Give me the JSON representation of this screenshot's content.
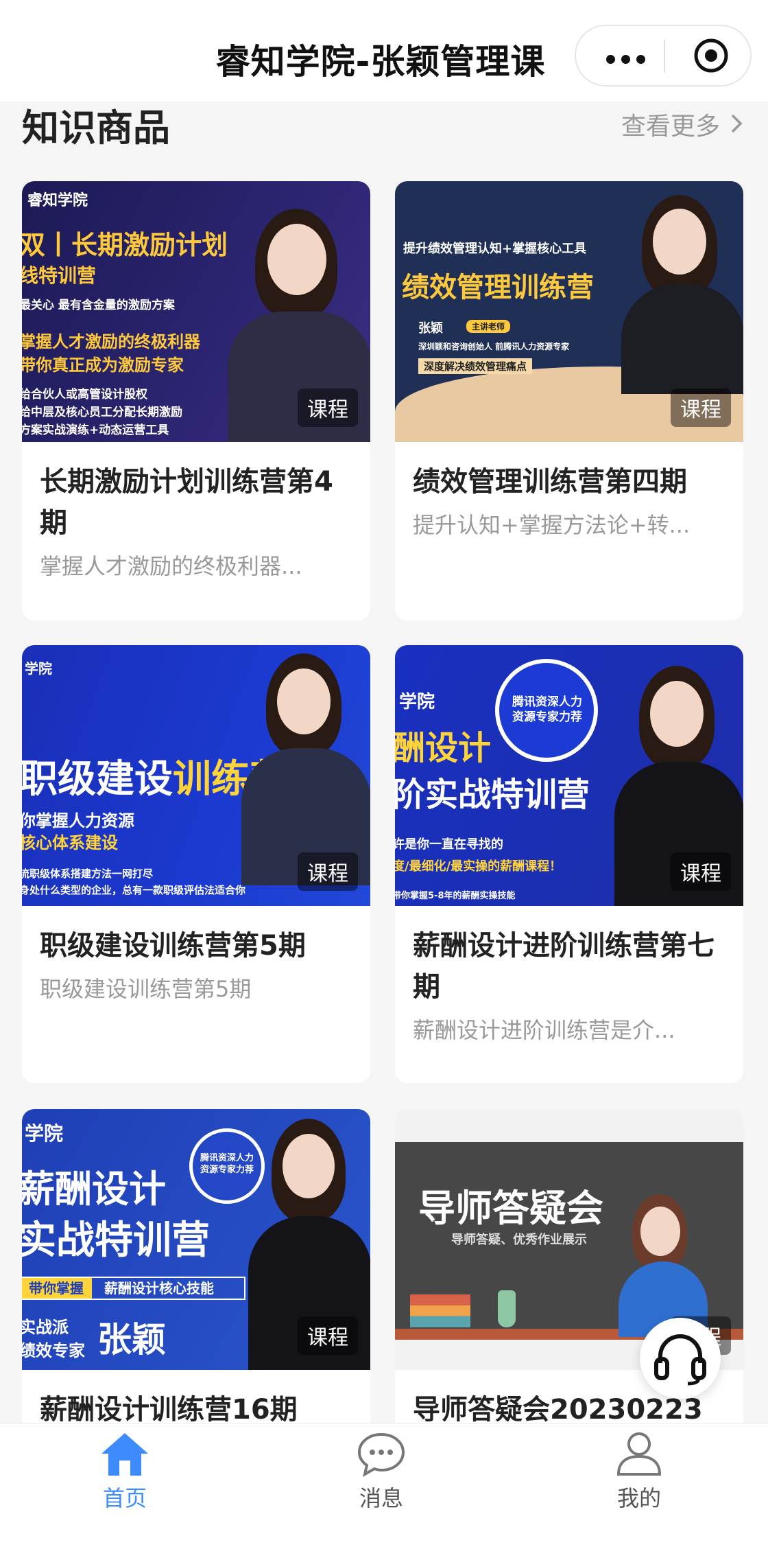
{
  "header": {
    "title": "睿知学院-张颖管理课"
  },
  "section": {
    "title": "知识商品",
    "more_label": "查看更多"
  },
  "cards": [
    {
      "title": "长期激励计划训练营第4期",
      "desc": "掌握人才激励的终极利器...",
      "tag": "课程",
      "thumb": {
        "logo": "睿知学院",
        "line1": "双丨长期激励计划",
        "line2": "线特训营",
        "line3": "最关心 最有含金量的激励方案",
        "line4": "掌握人才激励的终极利器",
        "line5": "带你真正成为激励专家",
        "line6": "给合伙人或高管设计股权",
        "line7": "给中层及核心员工分配长期激励",
        "line8": "方案实战演练+动态运营工具"
      }
    },
    {
      "title": "绩效管理训练营第四期",
      "desc": "提升认知+掌握方法论+转...",
      "tag": "课程",
      "thumb": {
        "line1": "提升绩效管理认知+掌握核心工具",
        "line2": "绩效管理训练营",
        "name": "张颖",
        "role": "主讲老师",
        "bio": "深圳颖和咨询创始人 前腾讯人力资源专家",
        "line3": "深度解决绩效管理痛点"
      }
    },
    {
      "title": "职级建设训练营第5期",
      "desc": "职级建设训练营第5期",
      "tag": "课程",
      "thumb": {
        "logo": "学院",
        "line1a": "职级建设",
        "line1b": "训练营",
        "line2": "你掌握人力资源",
        "line3": "核心体系建设",
        "line4": "流职级体系搭建方法一网打尽",
        "line5": "身处什么类型的企业，总有一款职级评估法适合你"
      }
    },
    {
      "title": "薪酬设计进阶训练营第七期",
      "desc": "薪酬设计进阶训练营是介...",
      "tag": "课程",
      "thumb": {
        "logo": "学院",
        "seal": "腾讯资深人力资源专家力荐",
        "line1": "酬设计",
        "line2": "阶实战特训营",
        "line3": "许是你一直在寻找的",
        "line4": "度/最细化/最实操的薪酬课程！",
        "line5": "带你掌握5-8年的薪酬实操技能"
      }
    },
    {
      "title": "薪酬设计训练营16期",
      "desc": "",
      "tag": "课程",
      "thumb": {
        "logo": "学院",
        "seal": "腾讯资深人力资源专家力荐",
        "line1": "薪酬设计",
        "line2": "实战特训营",
        "line3a": "带你掌握",
        "line3b": "薪酬设计核心技能",
        "line4a": "实战派",
        "line4b": "张颖",
        "line5": "绩效专家"
      }
    },
    {
      "title": "导师答疑会20230223",
      "desc": "",
      "tag": "课程",
      "thumb": {
        "line1": "导师答疑会",
        "line2": "导师答疑、优秀作业展示"
      }
    }
  ],
  "tabbar": {
    "items": [
      {
        "label": "首页",
        "active": true,
        "icon": "home-icon"
      },
      {
        "label": "消息",
        "active": false,
        "icon": "chat-icon"
      },
      {
        "label": "我的",
        "active": false,
        "icon": "user-icon"
      }
    ]
  },
  "colors": {
    "active": "#3d8bfd",
    "inactive": "#666666"
  }
}
